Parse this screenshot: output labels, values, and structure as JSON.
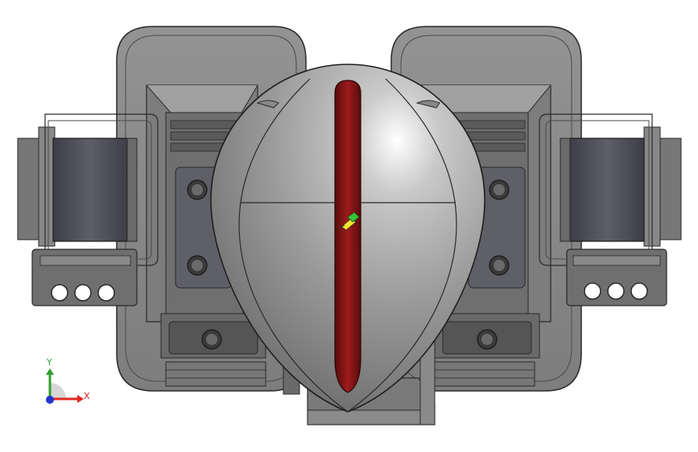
{
  "viewport": {
    "background": "#ffffff",
    "model_body_color": "#8a8a8a",
    "model_dark_color": "#5a5a5a",
    "edge_color": "#2a2a2a",
    "accent_slot_color": "#8b1515"
  },
  "triad": {
    "x_label": "X",
    "y_label": "Y",
    "x_color": "#e0261f",
    "y_color": "#2fa02f",
    "z_color": "#2233cc"
  },
  "icons": {
    "origin_marker": "pushpin-icon",
    "triad": "coordinate-triad-icon"
  }
}
